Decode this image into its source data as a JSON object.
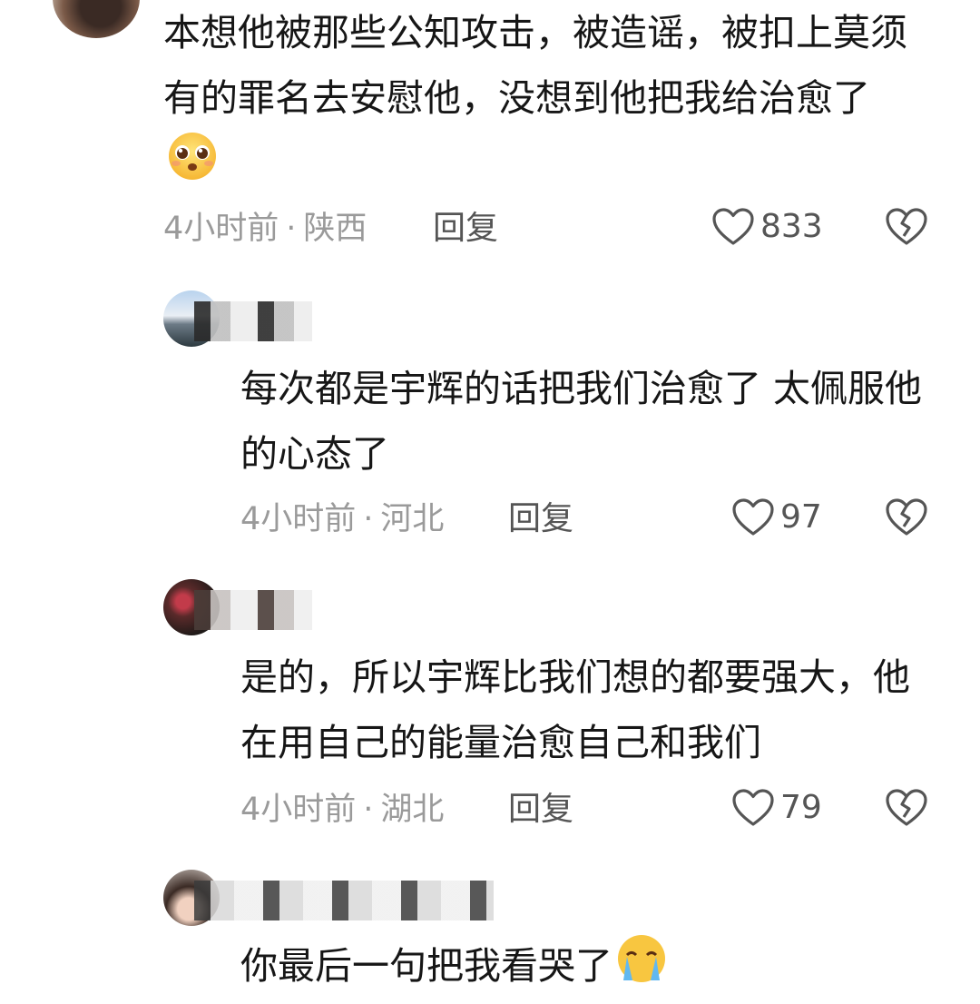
{
  "comments": [
    {
      "text": "本想他被那些公知攻击，被造谣，被扣上莫须有的罪名去安慰他，没想到他把我给治愈了",
      "emoji": "pleading-face-emoji",
      "time": "4小时前",
      "location": "陕西",
      "reply_label": "回复",
      "likes": "833"
    },
    {
      "text": "每次都是宇辉的话把我们治愈了 太佩服他的心态了",
      "time": "4小时前",
      "location": "河北",
      "reply_label": "回复",
      "likes": "97"
    },
    {
      "text": "是的，所以宇辉比我们想的都要强大，他在用自己的能量治愈自己和我们",
      "time": "4小时前",
      "location": "湖北",
      "reply_label": "回复",
      "likes": "79"
    },
    {
      "text": "你最后一句把我看哭了",
      "emoji": "crying-face-emoji"
    }
  ],
  "colors": {
    "text": "#161616",
    "meta": "#9a9a9a",
    "icon": "#555555"
  }
}
